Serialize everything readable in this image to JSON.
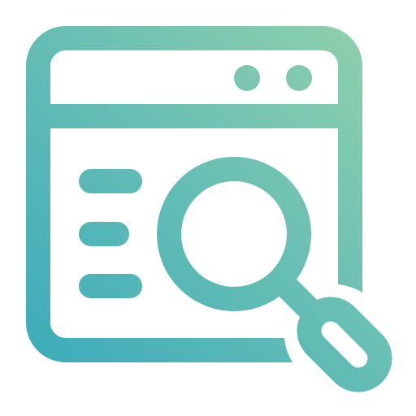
{
  "icon": {
    "name": "web-search-icon",
    "gradient": {
      "start": "#3aabbb",
      "end": "#90d0ad"
    }
  }
}
